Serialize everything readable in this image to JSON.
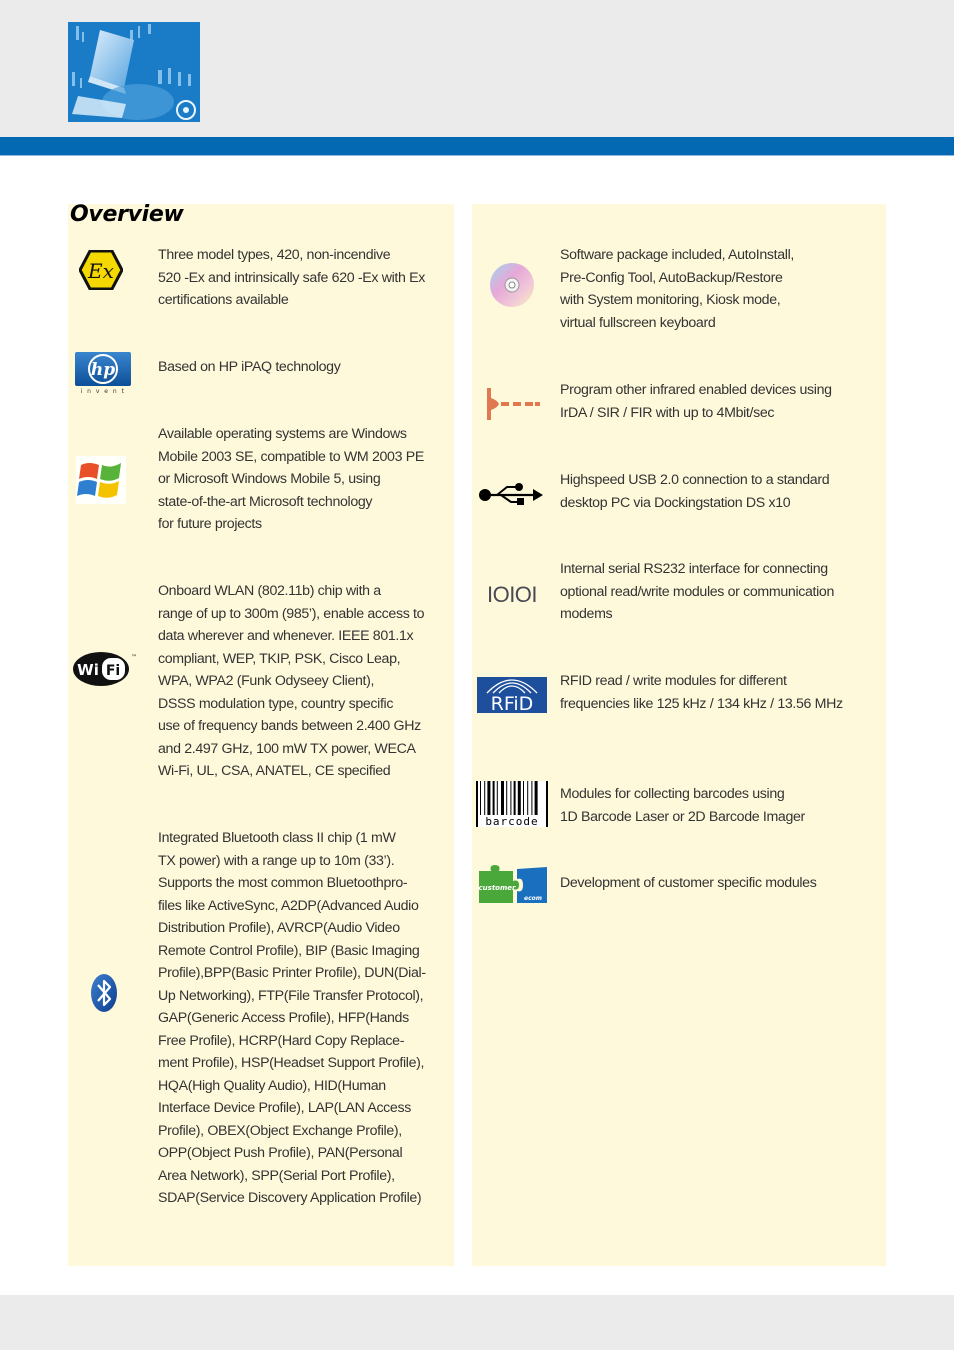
{
  "header": {
    "image_alt": "computer-network-banner",
    "bar_color": "#0369b2",
    "band_color": "#ebebeb"
  },
  "section": {
    "title": "Overview",
    "panel_color": "#fff9db"
  },
  "left_features": [
    {
      "icon": "ex-certification-icon",
      "text": "Three model types, 420,  non-incendive\n520 -Ex and intrinsically safe 620 -Ex with Ex\ncertifications available"
    },
    {
      "icon": "hp-invent-logo",
      "logo_caption": "i n v e n t",
      "text": "Based on HP iPAQ technology"
    },
    {
      "icon": "windows-logo",
      "text": "Available operating systems are Windows\nMobile 2003 SE, compatible to WM 2003 PE\nor Microsoft Windows Mobile 5, using\nstate-of-the-art Microsoft technology\nfor future projects"
    },
    {
      "icon": "wifi-logo",
      "logo_text_left": "Wi",
      "logo_text_right": "Fi",
      "logo_tm": "™",
      "text": "Onboard WLAN (802.11b) chip with a\nrange of up to 300m (985’), enable access to\ndata wherever and whenever.  IEEE 801.1x\ncompliant, WEP,  TKIP, PSK, Cisco Leap,\nWPA, WPA2 (Funk Odyseey Client),\nDSSS modulation type, country specific\nuse of frequency bands between 2.400 GHz\nand 2.497 GHz, 100 mW TX power, WECA\nWi-Fi, UL, CSA,  ANATEL, CE specified"
    },
    {
      "icon": "bluetooth-icon",
      "text": "Integrated Bluetooth class II chip (1 mW\nTX power) with a range up to 10m (33’).\nSupports the most common Bluetoothpro-\nfiles like ActiveSync, A2DP(Advanced Audio\nDistribution Profile), AVRCP(Audio Video\nRemote Control Profile), BIP (Basic Imaging\nProfile),BPP(Basic Printer Profile), DUN(Dial-\nUp Networking), FTP(File Transfer Protocol),\nGAP(Generic Access Profile),  HFP(Hands\nFree Profile), HCRP(Hard Copy Replace-\nment Profile), HSP(Headset Support Profile),\nHQA(High Quality Audio), HID(Human\nInterface Device Profile), LAP(LAN Access\nProfile), OBEX(Object Exchange Profile),\nOPP(Object Push Profile), PAN(Personal\nArea Network),  SPP(Serial Port Profile),\nSDAP(Service Discovery Application Profile)"
    }
  ],
  "right_features": [
    {
      "icon": "cd-disc-icon",
      "text": "Software package included, AutoInstall,\nPre-Config Tool, AutoBackup/Restore\nwith System monitoring, Kiosk mode,\nvirtual fullscreen keyboard"
    },
    {
      "icon": "infrared-icon",
      "text": "Program other infrared enabled devices using\nIrDA / SIR / FIR with up to 4Mbit/sec"
    },
    {
      "icon": "usb-icon",
      "text": "Highspeed USB 2.0 connection to a standard\ndesktop PC via Dockingstation DS x10"
    },
    {
      "icon": "serial-ioioi-icon",
      "logo_text": "IOIOI",
      "text": "Internal serial RS232 interface for connecting\noptional read/write modules or communication\nmodems"
    },
    {
      "icon": "rfid-logo",
      "logo_text": "RFiD",
      "text": "RFID read / write modules for different\nfrequencies like 125 kHz / 134 kHz / 13.56 MHz"
    },
    {
      "icon": "barcode-icon",
      "logo_text": "barcode",
      "text": "Modules for collecting barcodes using\n1D Barcode Laser or 2D Barcode Imager"
    },
    {
      "icon": "puzzle-customer-ecom-icon",
      "logo_text_left": "customer",
      "logo_text_right": "ecom",
      "text": "Development of customer specific modules"
    }
  ]
}
